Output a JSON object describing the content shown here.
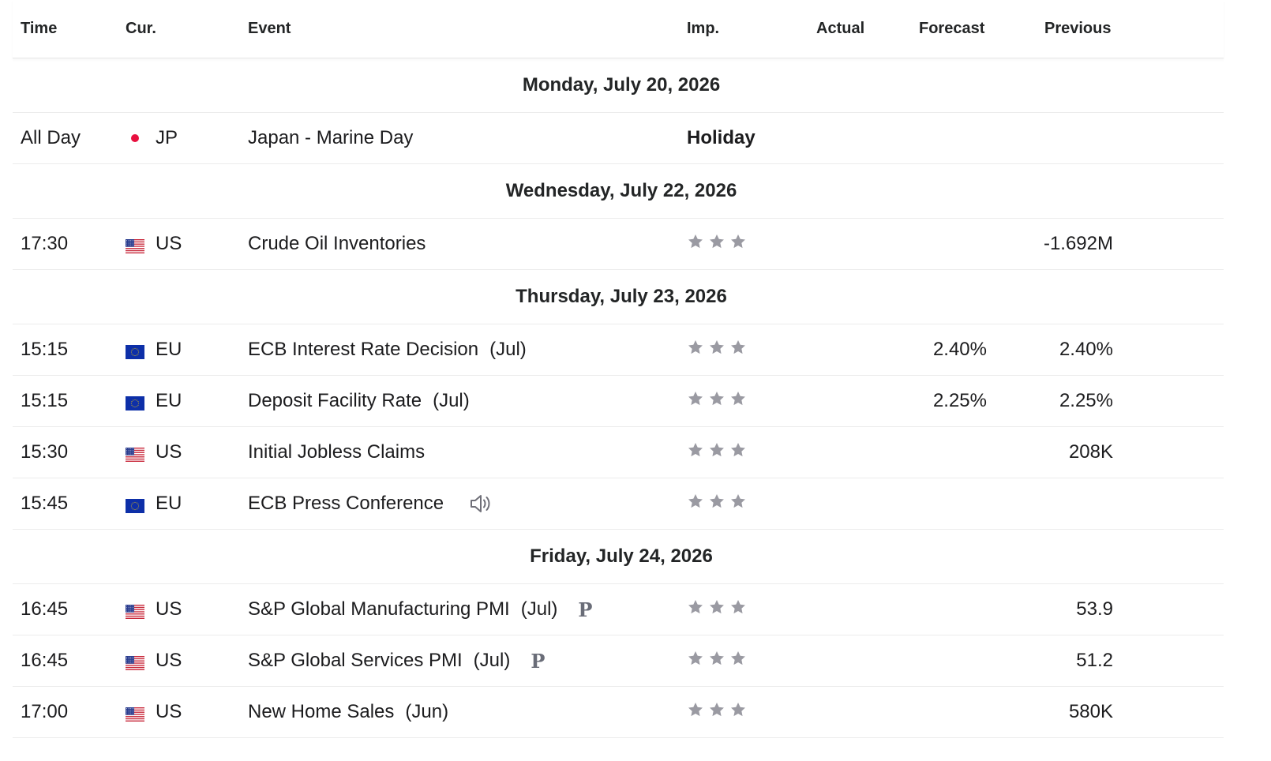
{
  "header": {
    "time": "Time",
    "currency": "Cur.",
    "event": "Event",
    "importance": "Imp.",
    "actual": "Actual",
    "forecast": "Forecast",
    "previous": "Previous"
  },
  "colors": {
    "star_inactive": "#9a9aa2",
    "jp_dot": "#e8103f",
    "eu_flag": "#0d2fa8",
    "us_red": "#c8283a"
  },
  "days": [
    {
      "date": "Monday, July 20, 2026",
      "events": [
        {
          "time": "All Day",
          "currency": "JP",
          "flag": "jp-flag-icon",
          "name": "Japan - Marine Day",
          "period": "",
          "importance_label": "Holiday",
          "importance_stars": 0,
          "actual": "",
          "forecast": "",
          "previous": ""
        }
      ]
    },
    {
      "date": "Wednesday, July 22, 2026",
      "events": [
        {
          "time": "17:30",
          "currency": "US",
          "flag": "us-flag-icon",
          "name": "Crude Oil Inventories",
          "period": "",
          "importance_stars": 3,
          "active_stars": 0,
          "actual": "",
          "forecast": "",
          "previous": "-1.692M"
        }
      ]
    },
    {
      "date": "Thursday, July 23, 2026",
      "events": [
        {
          "time": "15:15",
          "currency": "EU",
          "flag": "eu-flag-icon",
          "name": "ECB Interest Rate Decision",
          "period": "(Jul)",
          "importance_stars": 3,
          "active_stars": 0,
          "actual": "",
          "forecast": "2.40%",
          "previous": "2.40%"
        },
        {
          "time": "15:15",
          "currency": "EU",
          "flag": "eu-flag-icon",
          "name": "Deposit Facility Rate",
          "period": "(Jul)",
          "importance_stars": 3,
          "active_stars": 0,
          "actual": "",
          "forecast": "2.25%",
          "previous": "2.25%"
        },
        {
          "time": "15:30",
          "currency": "US",
          "flag": "us-flag-icon",
          "name": "Initial Jobless Claims",
          "period": "",
          "importance_stars": 3,
          "active_stars": 0,
          "actual": "",
          "forecast": "",
          "previous": "208K"
        },
        {
          "time": "15:45",
          "currency": "EU",
          "flag": "eu-flag-icon",
          "name": "ECB Press Conference",
          "period": "",
          "speaker": "speaker-icon",
          "importance_stars": 3,
          "active_stars": 0,
          "actual": "",
          "forecast": "",
          "previous": ""
        }
      ]
    },
    {
      "date": "Friday, July 24, 2026",
      "events": [
        {
          "time": "16:45",
          "currency": "US",
          "flag": "us-flag-icon",
          "name": "S&P Global Manufacturing PMI",
          "period": "(Jul)",
          "preliminary": "P",
          "importance_stars": 3,
          "active_stars": 0,
          "actual": "",
          "forecast": "",
          "previous": "53.9"
        },
        {
          "time": "16:45",
          "currency": "US",
          "flag": "us-flag-icon",
          "name": "S&P Global Services PMI",
          "period": "(Jul)",
          "preliminary": "P",
          "importance_stars": 3,
          "active_stars": 0,
          "actual": "",
          "forecast": "",
          "previous": "51.2"
        },
        {
          "time": "17:00",
          "currency": "US",
          "flag": "us-flag-icon",
          "name": "New Home Sales",
          "period": "(Jun)",
          "importance_stars": 3,
          "active_stars": 0,
          "actual": "",
          "forecast": "",
          "previous": "580K"
        }
      ]
    }
  ]
}
